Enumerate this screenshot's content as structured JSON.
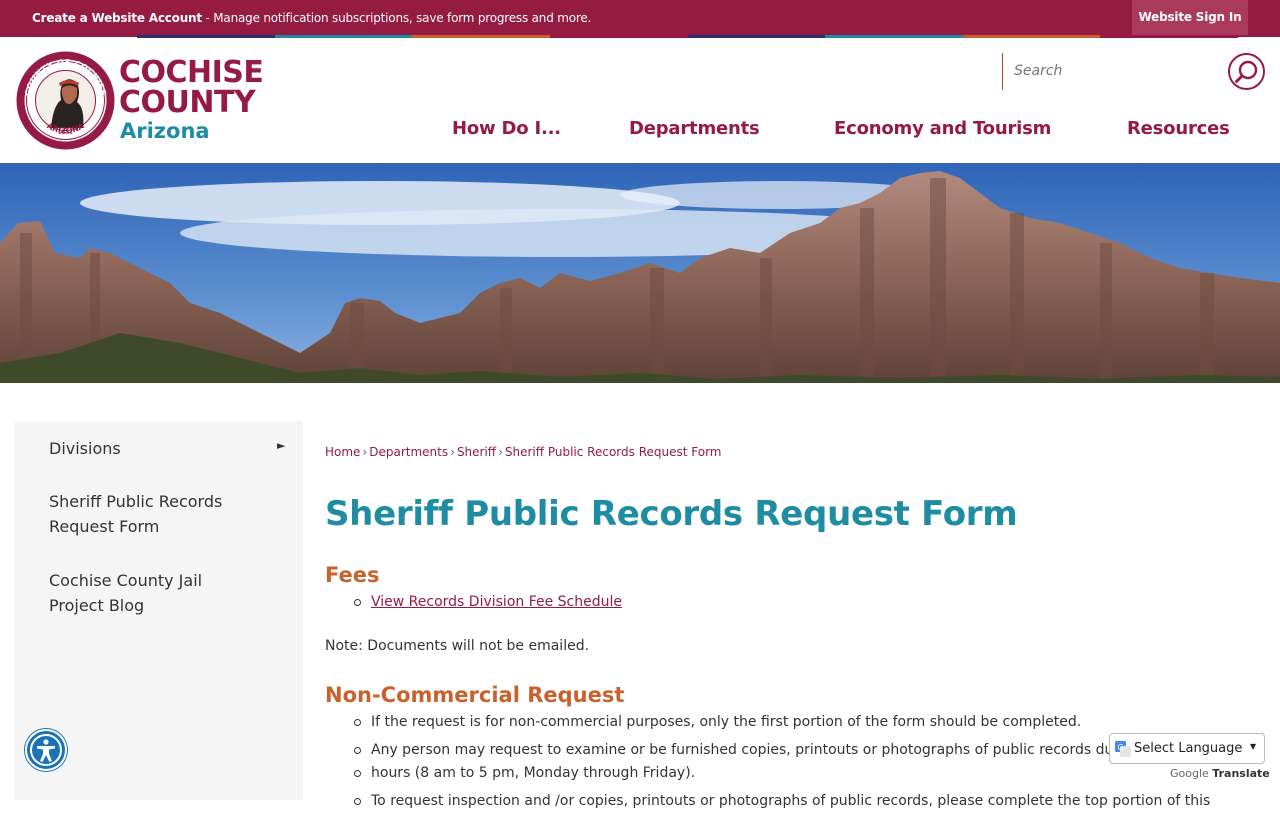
{
  "topbar": {
    "create_account": "Create a Website Account",
    "message": " - Manage notification subscriptions, save form progress and more.",
    "sign_in": "Website Sign In"
  },
  "stripe_colors": [
    "#2d2f75",
    "#1e8da3",
    "#c8612b",
    "#951b42",
    "#2d2f75",
    "#1e8da3",
    "#c8612b",
    "#951b42"
  ],
  "logo": {
    "line1": "COCHISE",
    "line2": "COUNTY",
    "line3": "Arizona",
    "seal_text_top": "COUNTY OF COCHISE",
    "seal_text_bottom": "ARIZONA",
    "seal_year": "1881"
  },
  "search": {
    "placeholder": "Search",
    "icon": "search-icon"
  },
  "nav": [
    "How Do I...",
    "Departments",
    "Economy and Tourism",
    "Resources"
  ],
  "sidebar": {
    "items": [
      {
        "label": "Divisions",
        "has_submenu": true
      },
      {
        "label_line1": "Sheriff Public Records",
        "label_line2": "Request Form"
      },
      {
        "label_line1": "Cochise County Jail",
        "label_line2": "Project Blog"
      }
    ]
  },
  "breadcrumb": [
    "Home",
    "Departments",
    "Sheriff",
    "Sheriff Public Records Request Form"
  ],
  "content": {
    "title": "Sheriff Public Records Request Form",
    "fees_heading": "Fees",
    "fees_link": "View Records Division Fee Schedule",
    "note": "Note: Documents will not be emailed.",
    "noncommercial_heading": "Non-Commercial Request",
    "bullets": [
      "If the request is for non-commercial purposes, only the first portion of the form should be completed.",
      "Any person may request to examine or be furnished copies, printouts or photographs of public records du",
      "hours (8 am to 5 pm, Monday through Friday).",
      "To request inspection and /or copies, printouts or photographs of public records, please complete the top portion of this"
    ]
  },
  "translate": {
    "select_label": "Select Language",
    "powered_by": "Google",
    "translate_word": "Translate"
  },
  "colors": {
    "brand_maroon": "#951b42",
    "brand_teal": "#1e8da3",
    "heading_orange": "#c8612b",
    "accessibility_blue": "#1a73b8"
  }
}
